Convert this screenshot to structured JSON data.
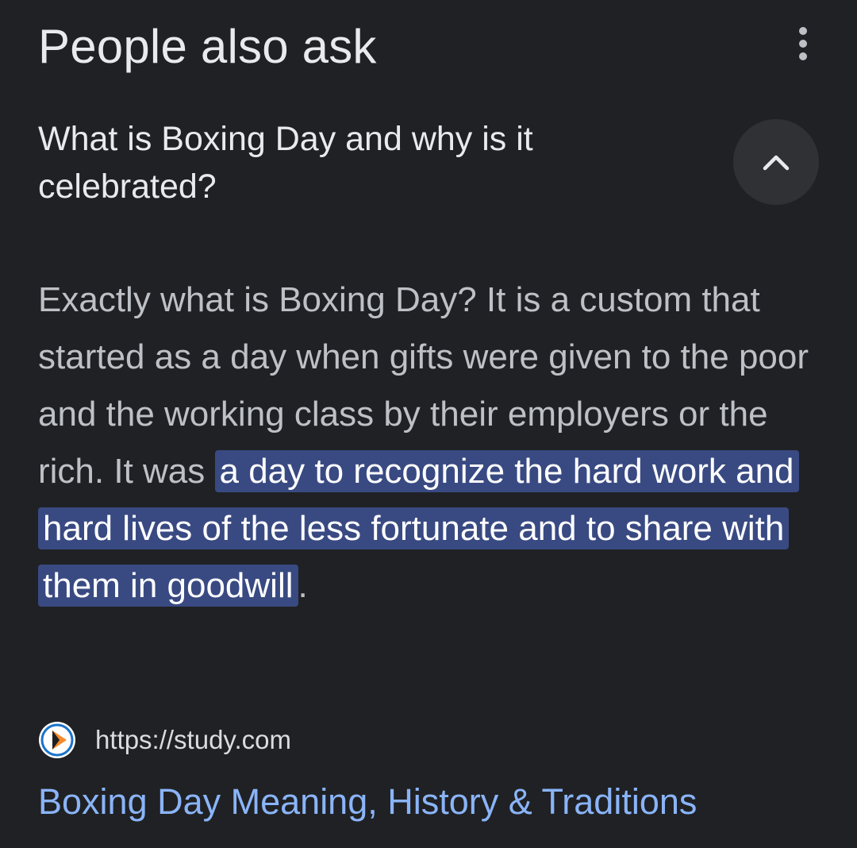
{
  "header": {
    "title": "People also ask",
    "more_icon": "more-vert-icon"
  },
  "question": {
    "text": "What is Boxing Day and why is it celebrated?",
    "toggle_icon": "chevron-up-icon"
  },
  "answer": {
    "text_before": "Exactly what is Boxing Day? It is a custom that started as a day when gifts were given to the poor and the working class by their employers or the rich. It was",
    "highlighted": "a day to recognize the hard work and hard lives of the less fortunate and to share with them in goodwill",
    "text_after": "."
  },
  "source": {
    "favicon": "study-com-play-icon",
    "url": "https://study.com"
  },
  "result": {
    "title": "Boxing Day Meaning, History & Traditions"
  },
  "colors": {
    "background": "#202124",
    "link": "#8ab4f8",
    "highlight": "#394a82",
    "button_bg": "#303134"
  }
}
